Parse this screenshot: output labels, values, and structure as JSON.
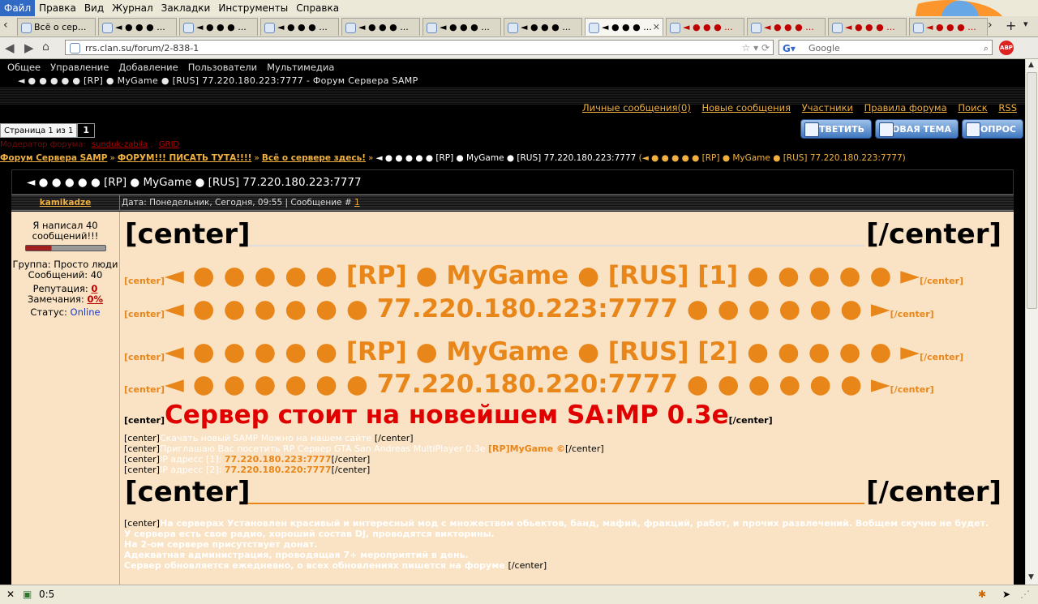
{
  "browser": {
    "menu": [
      "Файл",
      "Правка",
      "Вид",
      "Журнал",
      "Закладки",
      "Инструменты",
      "Справка"
    ],
    "tabs": [
      {
        "label": "Всё о сер...",
        "red": false
      },
      {
        "label": "◄ ● ● ● ...",
        "red": false
      },
      {
        "label": "◄ ● ● ● ...",
        "red": false
      },
      {
        "label": "◄ ● ● ● ...",
        "red": false
      },
      {
        "label": "◄ ● ● ● ...",
        "red": false
      },
      {
        "label": "◄ ● ● ● ...",
        "red": false
      },
      {
        "label": "◄ ● ● ● ...",
        "red": false
      },
      {
        "label": "◄ ● ● ● ...",
        "red": false
      },
      {
        "label": "◄ ● ● ● ...",
        "red": true
      },
      {
        "label": "◄ ● ● ● ...",
        "red": true
      },
      {
        "label": "◄ ● ● ● ...",
        "red": true
      },
      {
        "label": "◄ ● ● ● ...",
        "red": true
      }
    ],
    "url": "rrs.clan.su/forum/2-838-1",
    "search_placeholder": "Google",
    "abp_label": "ABP",
    "status_text": "0:5"
  },
  "site": {
    "menu": [
      "Общее",
      "Управление",
      "Добавление",
      "Пользователи",
      "Мультимедиа"
    ],
    "page_title": "◄ ● ● ● ● ● [RP] ● MyGame ● [RUS] 77.220.180.223:7777 - Форум Сервера SAMP",
    "top_links": [
      "Личные сообщения(0)",
      "Новые сообщения",
      "Участники",
      "Правила форума",
      "Поиск",
      "RSS"
    ],
    "pager_label": "Страница 1 из 1",
    "pager_num": "1",
    "gray_text": "Модератор форума:",
    "gray_links": [
      "sunduk-zabila",
      "GRID"
    ],
    "buttons": {
      "reply": "ОТВЕТИТЬ",
      "new_topic": "НОВАЯ ТЕМА",
      "poll": "ОПРОС"
    },
    "breadcrumbs": {
      "links": [
        "Форум Сервера SAMP",
        "ФОРУМ!!! ПИСАТЬ ТУТА!!!!",
        "Всё о сервере здесь!"
      ],
      "current": "◄ ● ● ● ● ● [RP] ● MyGame ● [RUS] 77.220.180.223:7777",
      "parenthetical": "(◄ ● ● ● ● ● [RP] ● MyGame ● [RUS] 77.220.180.223:7777)"
    }
  },
  "post": {
    "topic_title": "◄ ● ● ● ● ● [RP] ● MyGame ● [RUS] 77.220.180.223:7777",
    "author": "kamikadze",
    "date_text": "Дата: Понедельник, Сегодня, 09:55 | Сообщение #",
    "msg_num": "1",
    "user": {
      "rank": "Я написал 40 сообщений!!!",
      "group": "Группа: Просто люди",
      "messages": "Сообщений: 40",
      "rep_label": "Репутация:",
      "rep_value": "0",
      "warn_label": "Замечания:",
      "warn_value": "0%",
      "status_label": "Статус:",
      "status_value": "Online"
    },
    "center_open": "[center]",
    "center_close": "[/center]",
    "lines": [
      {
        "text": "◄ ● ● ● ● ● [RP] ● MyGame ● [RUS] [1] ● ● ● ● ● ►"
      },
      {
        "text": "◄ ● ● ● ● ● ● 77.220.180.223:7777 ● ● ● ● ● ● ►"
      },
      {
        "text": "◄ ● ● ● ● ● [RP] ● MyGame ● [RUS] [2] ● ● ● ● ● ►"
      },
      {
        "text": "◄ ● ● ● ● ● ● 77.220.180.220:7777 ● ● ● ● ● ● ►"
      }
    ],
    "red_line": "Сервер стоит на новейшем SA:MP 0.3e",
    "small_lines": [
      {
        "pre": "Скачать новый SAMP Можно на нашем сайте",
        "hl": ""
      },
      {
        "pre": "Приглашаю Вас посетить RP Сервер GTA San Andreas MultiPlayer 0.3e ",
        "hl": "[RP]MyGame ©"
      },
      {
        "pre": "IP адресс [1]: ",
        "hl": "77.220.180.223:7777"
      },
      {
        "pre": "IP адресс [2]: ",
        "hl": "77.220.180.220:7777"
      }
    ],
    "paragraph": [
      "На серверах Установлен красивый и интересный мод с множеством обьектов, банд, мафий, фракций, работ, и прочих развлечений. Вобщем скучно не будет.",
      "У сервера есть свое радио, хороший состав DJ, проводятся викторины.",
      "На 2-ом сервере присутствует донат.",
      "Адекватная администрация, проводящая 7+ мероприятий в день.",
      "Сервер обновляется ежедневно, о всех обновлениях пишется на форуме"
    ]
  }
}
